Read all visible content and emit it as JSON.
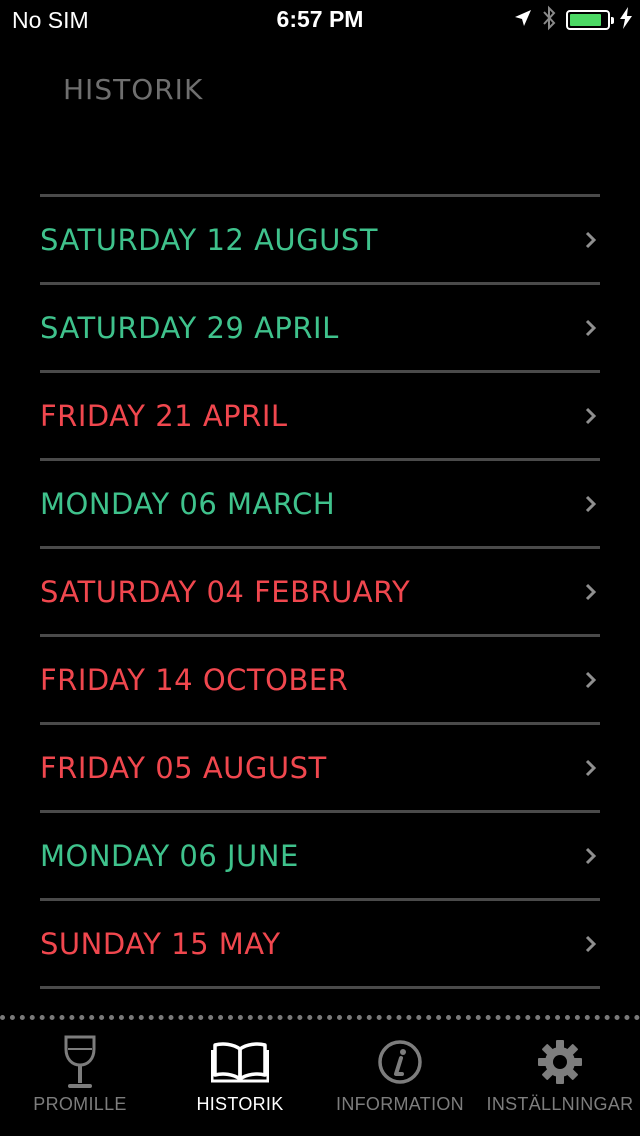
{
  "status_bar": {
    "carrier": "No SIM",
    "time": "6:57 PM",
    "battery_level": 0.85,
    "icons": [
      "location-arrow-icon",
      "bluetooth-icon",
      "battery-icon",
      "charging-bolt-icon"
    ]
  },
  "header": {
    "title": "HISTORIK"
  },
  "colors": {
    "green": "#3fc28c",
    "red": "#f0474e",
    "inactive_tab": "#7d7d7d",
    "active_tab": "#ffffff",
    "divider": "#4a4a4a",
    "title": "#6f6f6f"
  },
  "history": [
    {
      "label": "SATURDAY 12 AUGUST",
      "status": "green"
    },
    {
      "label": "SATURDAY 29 APRIL",
      "status": "green"
    },
    {
      "label": "FRIDAY 21 APRIL",
      "status": "red"
    },
    {
      "label": "MONDAY 06 MARCH",
      "status": "green"
    },
    {
      "label": "SATURDAY 04 FEBRUARY",
      "status": "red"
    },
    {
      "label": "FRIDAY 14 OCTOBER",
      "status": "red"
    },
    {
      "label": "FRIDAY 05 AUGUST",
      "status": "red"
    },
    {
      "label": "MONDAY 06 JUNE",
      "status": "green"
    },
    {
      "label": "SUNDAY 15 MAY",
      "status": "red"
    }
  ],
  "tabs": [
    {
      "label": "PROMILLE",
      "icon": "wine-glass-icon",
      "active": false
    },
    {
      "label": "HISTORIK",
      "icon": "book-icon",
      "active": true
    },
    {
      "label": "INFORMATION",
      "icon": "info-icon",
      "active": false
    },
    {
      "label": "INSTÄLLNINGAR",
      "icon": "gear-icon",
      "active": false
    }
  ]
}
